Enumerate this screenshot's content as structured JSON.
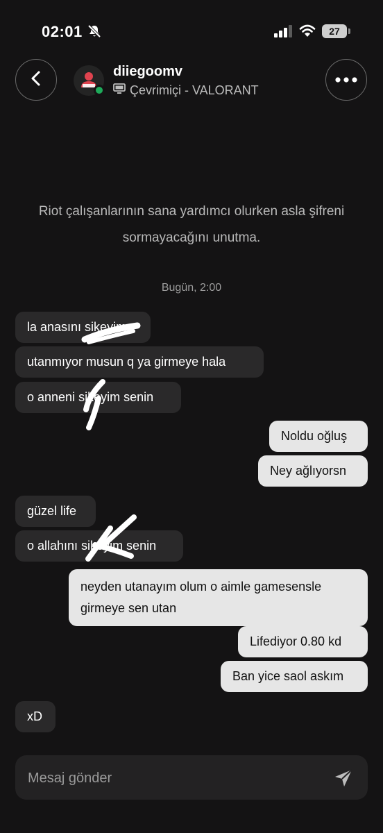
{
  "status_bar": {
    "time": "02:01",
    "battery": "27",
    "icons": [
      "bell-slash-icon",
      "cellular-signal-icon",
      "wifi-icon",
      "battery-icon"
    ]
  },
  "header": {
    "username": "diiegoomv",
    "presence": "Çevrimiçi - VALORANT",
    "online_color": "#1eaa5a",
    "icons": [
      "back-arrow-icon",
      "avatar-person-icon",
      "monitor-icon",
      "more-dots-icon"
    ]
  },
  "notice": "Riot çalışanlarının sana yardımcı olurken asla şifreni sormayacağını unutma.",
  "daystamp": "Bugün, 2:00",
  "messages": [
    {
      "side": "in",
      "text": "la anasını sikeyim"
    },
    {
      "side": "in",
      "text": "utanmıyor musun q ya girmeye hala"
    },
    {
      "side": "in",
      "text": "o anneni sikeyim senin"
    },
    {
      "side": "out",
      "text": "Noldu oğluş"
    },
    {
      "side": "out",
      "text": "Ney ağlıyorsn"
    },
    {
      "side": "in",
      "text": "güzel life"
    },
    {
      "side": "in",
      "text": "o allahını sikeyim senin"
    },
    {
      "side": "out",
      "text": "neyden utanayım olum o aimle gamesensle girmeye sen utan"
    },
    {
      "side": "out",
      "text": "Lifediyor 0.80 kd"
    },
    {
      "side": "out",
      "text": "Ban yice saol askım"
    },
    {
      "side": "in",
      "text": "xD"
    }
  ],
  "composer": {
    "placeholder": "Mesaj gönder",
    "send_icon": "send-icon"
  },
  "colors": {
    "background": "#141314",
    "incoming_bubble": "#2a292a",
    "outgoing_bubble": "#e6e6e6",
    "avatar_accent": "#e0434f"
  }
}
